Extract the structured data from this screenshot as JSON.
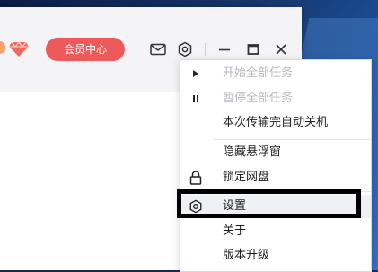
{
  "titlebar": {
    "vip_label": "会员中心",
    "icons": [
      "diamond-icon",
      "mail-icon",
      "settings-icon",
      "minimize-icon",
      "maximize-icon",
      "close-icon"
    ]
  },
  "colors": {
    "vip_red": "#ee5a5a",
    "accent_orange": "#f3a16d"
  },
  "menu": {
    "items": [
      {
        "label": "开始全部任务",
        "icon": "play-icon",
        "enabled": false
      },
      {
        "label": "暂停全部任务",
        "icon": "pause-icon",
        "enabled": false
      },
      {
        "label": "本次传输完自动关机",
        "icon": "",
        "enabled": true
      },
      {
        "label": "隐藏悬浮窗",
        "icon": "",
        "enabled": true
      },
      {
        "label": "锁定网盘",
        "icon": "lock-icon",
        "enabled": true
      },
      {
        "label": "设置",
        "icon": "settings-icon",
        "enabled": true,
        "hovered": true
      },
      {
        "label": "关于",
        "icon": "",
        "enabled": true
      },
      {
        "label": "版本升级",
        "icon": "",
        "enabled": true
      }
    ]
  }
}
